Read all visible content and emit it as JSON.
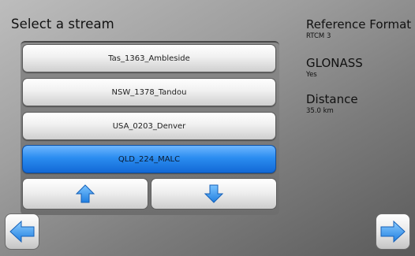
{
  "page": {
    "title": "Select a stream"
  },
  "streams": [
    {
      "label": "Tas_1363_Ambleside",
      "selected": false
    },
    {
      "label": "NSW_1378_Tandou",
      "selected": false
    },
    {
      "label": "USA_0203_Denver",
      "selected": false
    },
    {
      "label": "QLD_224_MALC",
      "selected": true
    }
  ],
  "scroll": {
    "up_icon": "arrow-up-icon",
    "down_icon": "arrow-down-icon"
  },
  "info": {
    "reference_format": {
      "heading": "Reference Format",
      "value": "RTCM 3"
    },
    "glonass": {
      "heading": "GLONASS",
      "value": "Yes"
    },
    "distance": {
      "heading": "Distance",
      "value": "35.0 km"
    }
  },
  "navigation": {
    "back_icon": "arrow-left-icon",
    "next_icon": "arrow-right-icon"
  },
  "colors": {
    "accent": "#2b8df0",
    "arrow_blue": "#3aa0f5",
    "text": "#111111"
  }
}
